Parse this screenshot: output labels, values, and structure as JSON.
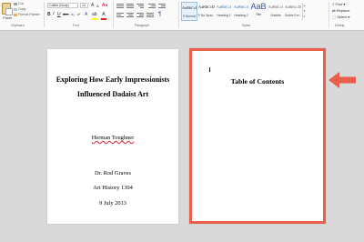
{
  "ribbon": {
    "clipboard": {
      "paste_label": "Paste",
      "cut_label": "Cut",
      "copy_label": "Copy",
      "format_painter_label": "Format Painter",
      "group_label": "Clipboard"
    },
    "font": {
      "font_name": "Calibri (Body)",
      "font_size": "14",
      "group_label": "Font",
      "bold": "B",
      "italic": "I",
      "underline": "U",
      "strike": "abc",
      "subscript": "x₂",
      "superscript": "x²",
      "font_color_letter": "A",
      "text_highlight_color": "#ffff00",
      "font_color": "#e02020"
    },
    "paragraph": {
      "group_label": "Paragraph"
    },
    "styles": {
      "group_label": "Styles",
      "items": [
        {
          "sample": "AaBbCcDc",
          "name": "¶ Normal",
          "active": true
        },
        {
          "sample": "AaBbCcDc",
          "name": "¶ No Spac..."
        },
        {
          "sample": "AaBbCcI",
          "name": "Heading 1"
        },
        {
          "sample": "AaBbCcI",
          "name": "Heading 2"
        },
        {
          "sample": "AaB",
          "name": "Title"
        },
        {
          "sample": "AaBbCcI",
          "name": "Subtitle"
        },
        {
          "sample": "AaBbCcDc",
          "name": "Subtle Em..."
        }
      ]
    },
    "editing": {
      "group_label": "Editing",
      "find_label": "Find",
      "replace_label": "Replace",
      "select_label": "Select"
    }
  },
  "document": {
    "title_page": {
      "title_line1": "Exploring How Early Impressionists",
      "title_line2": "Influenced Dadaist Art",
      "author": "Herman Toughner",
      "instructor": "Dr. Rod Graves",
      "course": "Art History 1304",
      "date": "9 July 2013"
    },
    "toc_page": {
      "heading": "Table of Contents"
    }
  },
  "colors": {
    "highlight_border": "#e8604c",
    "arrow": "#e8604c",
    "ribbon_accent": "#2b579a"
  }
}
